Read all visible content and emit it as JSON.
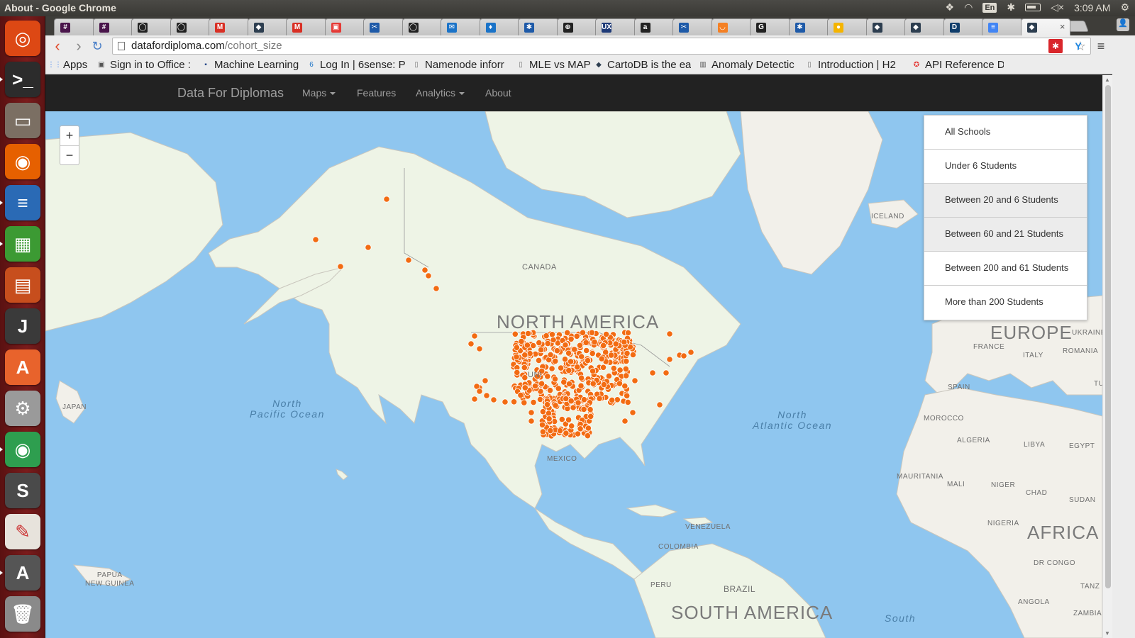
{
  "system": {
    "window_title": "About - Google Chrome",
    "keyboard": "En",
    "time": "3:09 AM"
  },
  "launcher": {
    "items": [
      {
        "name": "ubuntu-dash-icon",
        "glyph": "◎",
        "color": "#dd4814"
      },
      {
        "name": "terminal-icon",
        "glyph": ">_",
        "color": "#2c2c2c"
      },
      {
        "name": "file-manager-icon",
        "glyph": "▭",
        "color": "#7b6f63"
      },
      {
        "name": "firefox-icon",
        "glyph": "◉",
        "color": "#e66000"
      },
      {
        "name": "libreoffice-writer-icon",
        "glyph": "≡",
        "color": "#2a6ab5"
      },
      {
        "name": "libreoffice-calc-icon",
        "glyph": "▦",
        "color": "#3c9a33"
      },
      {
        "name": "libreoffice-impress-icon",
        "glyph": "▤",
        "color": "#c74e1d"
      },
      {
        "name": "jetbrains-idea-icon",
        "glyph": "J",
        "color": "#3a3a3a"
      },
      {
        "name": "software-center-icon",
        "glyph": "A",
        "color": "#e8632c"
      },
      {
        "name": "system-settings-icon",
        "glyph": "⚙",
        "color": "#9a9a9a"
      },
      {
        "name": "chrome-icon",
        "glyph": "◉",
        "color": "#2e9e4f"
      },
      {
        "name": "sublime-text-icon",
        "glyph": "S",
        "color": "#4a4a4a"
      },
      {
        "name": "text-editor-icon",
        "glyph": "✎",
        "color": "#e7e3dc"
      },
      {
        "name": "software-updater-icon",
        "glyph": "A",
        "color": "#555555"
      },
      {
        "name": "trash-icon",
        "glyph": "🗑",
        "color": "#8a8a8a"
      }
    ]
  },
  "tabs": [
    {
      "icon": "#",
      "color": "#4a154b"
    },
    {
      "icon": "#",
      "color": "#4a154b"
    },
    {
      "icon": "◯",
      "color": "#222222"
    },
    {
      "icon": "◯",
      "color": "#222222"
    },
    {
      "icon": "M",
      "color": "#d93025"
    },
    {
      "icon": "◆",
      "color": "#2d3e50"
    },
    {
      "icon": "M",
      "color": "#d93025"
    },
    {
      "icon": "▣",
      "color": "#e53935"
    },
    {
      "icon": "✂",
      "color": "#1e5aa8"
    },
    {
      "icon": "◯",
      "color": "#222222"
    },
    {
      "icon": "✉",
      "color": "#1a73c8"
    },
    {
      "icon": "♦",
      "color": "#1a73c8"
    },
    {
      "icon": "✱",
      "color": "#1e5aa8"
    },
    {
      "icon": "⊕",
      "color": "#222222"
    },
    {
      "icon": "UX",
      "color": "#1e3a78"
    },
    {
      "icon": "a",
      "color": "#222222"
    },
    {
      "icon": "✂",
      "color": "#1e5aa8"
    },
    {
      "icon": "◡",
      "color": "#f48024"
    },
    {
      "icon": "G",
      "color": "#222222"
    },
    {
      "icon": "✱",
      "color": "#1e5aa8"
    },
    {
      "icon": "●",
      "color": "#f5b400"
    },
    {
      "icon": "◆",
      "color": "#2d3e50"
    },
    {
      "icon": "◆",
      "color": "#2d3e50"
    },
    {
      "icon": "D",
      "color": "#0f3d6b"
    },
    {
      "icon": "≡",
      "color": "#4285f4"
    },
    {
      "icon": "◆",
      "color": "#2d3e50"
    }
  ],
  "toolbar": {
    "url_domain": "datafordiploma.com",
    "url_path": "/cohort_size"
  },
  "bookmarks": [
    {
      "label": "Apps",
      "icon": "⋮⋮",
      "color": "#4285f4"
    },
    {
      "label": "Sign in to Office :",
      "icon": "▣",
      "color": "#555555"
    },
    {
      "label": "Machine Learning",
      "icon": "▪",
      "color": "#2a4a8a"
    },
    {
      "label": "Log In | 6sense: P",
      "icon": "6",
      "color": "#1a73c8"
    },
    {
      "label": "Namenode inforr",
      "icon": "▯",
      "color": "#777777"
    },
    {
      "label": "MLE vs MAP",
      "icon": "▯",
      "color": "#777777"
    },
    {
      "label": "CartoDB is the ea",
      "icon": "◆",
      "color": "#2d3e50"
    },
    {
      "label": "Anomaly Detectic",
      "icon": "▥",
      "color": "#555555"
    },
    {
      "label": "Introduction | H2",
      "icon": "▯",
      "color": "#777777"
    },
    {
      "label": "API Reference Da",
      "icon": "✪",
      "color": "#e53935"
    }
  ],
  "navbar": {
    "brand": "Data For Diplomas",
    "links": [
      "Maps",
      "Features",
      "Analytics",
      "About"
    ]
  },
  "map": {
    "labels": {
      "north_america": "NORTH AMERICA",
      "canada": "CANADA",
      "mexico": "MEXICO",
      "iceland": "ICELAND",
      "europe": "EUROPE",
      "ukraine": "UKRAINE",
      "france": "FRANCE",
      "romania": "ROMANIA",
      "italy": "ITALY",
      "spain": "SPAIN",
      "tu": "TU",
      "morocco": "MOROCCO",
      "algeria": "ALGERIA",
      "libya": "LIBYA",
      "egypt": "EGYPT",
      "mauritania": "MAURITANIA",
      "mali": "MALI",
      "niger": "NIGER",
      "chad": "CHAD",
      "sudan": "SUDAN",
      "nigeria": "NIGERIA",
      "africa": "AFRICA",
      "dr_congo": "DR CONGO",
      "angola": "ANGOLA",
      "zambia": "ZAMBIA",
      "tanz": "TANZ",
      "venezuela": "VENEZUELA",
      "colombia": "COLOMBIA",
      "peru": "PERU",
      "brazil": "BRAZIL",
      "south_america": "SOUTH AMERICA",
      "japan": "JAPAN",
      "papua": "PAPUA\nNEW GUINEA",
      "us_partial": "UNI",
      "north_pacific": "North\nPacific Ocean",
      "north_atlantic": "North\nAtlantic Ocean",
      "south": "South"
    },
    "zoom_in": "+",
    "zoom_out": "−",
    "marker_color": "#f26b12"
  },
  "legend": {
    "items": [
      "All Schools",
      "Under 6 Students",
      "Between 20 and 6 Students",
      "Between 60 and 21 Students",
      "Between 200 and 61 Students",
      "More than 200 Students"
    ]
  }
}
